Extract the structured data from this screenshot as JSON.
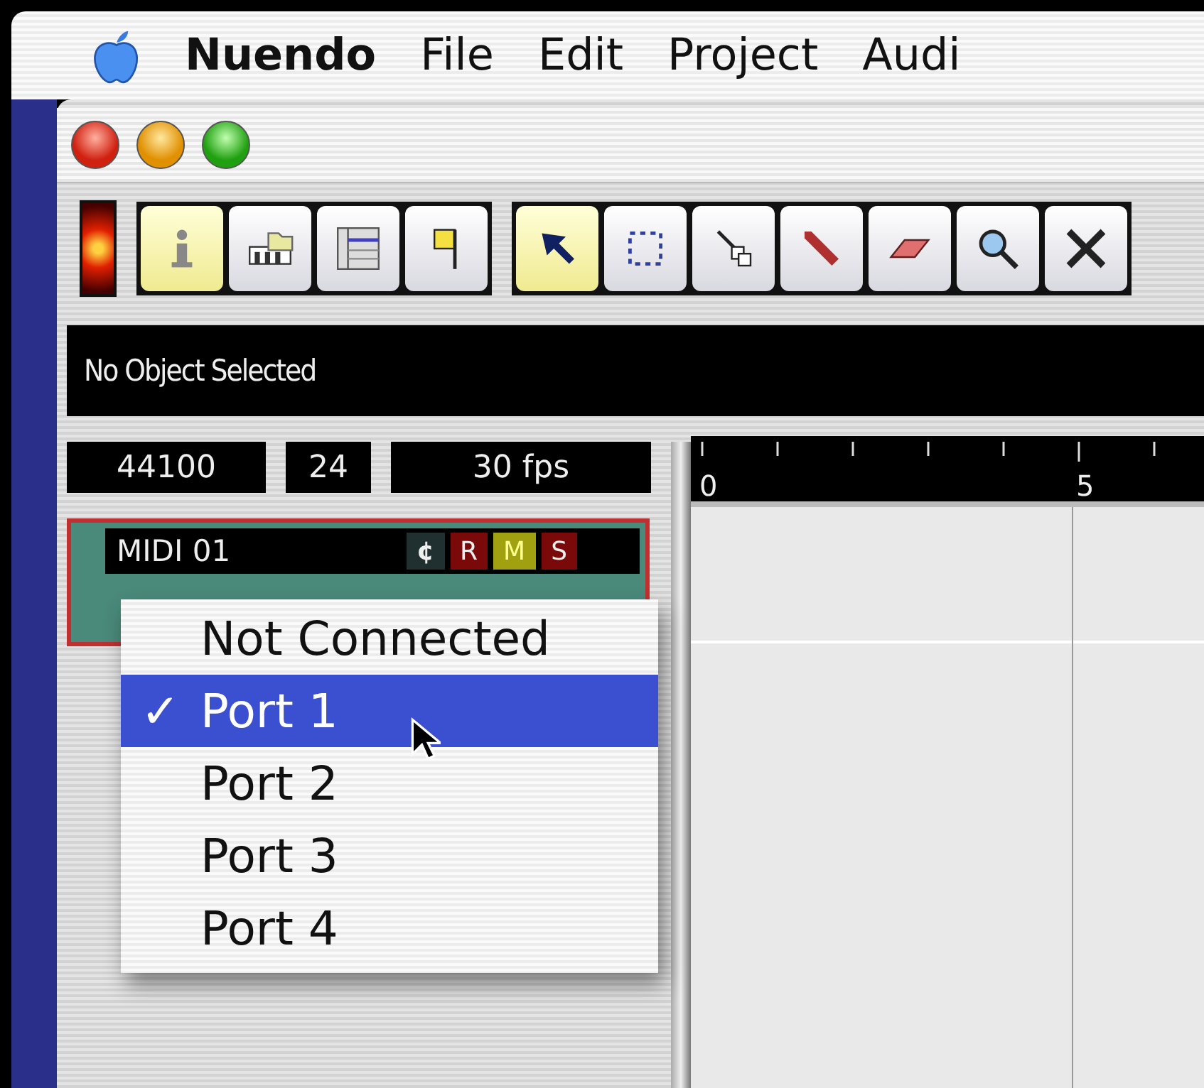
{
  "menu_bar": {
    "items": [
      {
        "label": "Nuendo",
        "kind": "app"
      },
      {
        "label": "File",
        "kind": "menu"
      },
      {
        "label": "Edit",
        "kind": "menu"
      },
      {
        "label": "Project",
        "kind": "menu"
      },
      {
        "label": "Audi",
        "kind": "menu"
      }
    ]
  },
  "toolbar": {
    "activity_led": {
      "on": true
    },
    "groups": [
      [
        {
          "kind": "info",
          "selected": true
        },
        {
          "kind": "pool",
          "selected": false
        },
        {
          "kind": "browser",
          "selected": false
        },
        {
          "kind": "marker",
          "selected": false
        }
      ],
      [
        {
          "kind": "arrow",
          "selected": true
        },
        {
          "kind": "range",
          "selected": false
        },
        {
          "kind": "split",
          "selected": false
        },
        {
          "kind": "glue",
          "selected": false
        },
        {
          "kind": "erase",
          "selected": false
        },
        {
          "kind": "zoom",
          "selected": false
        },
        {
          "kind": "mute",
          "selected": false
        }
      ]
    ]
  },
  "info_line": {
    "text": "No Object Selected"
  },
  "project_settings": [
    "44100",
    "24",
    "30 fps"
  ],
  "ruler": {
    "labels": [
      {
        "text": "0"
      },
      {
        "text": "5"
      }
    ]
  },
  "track": {
    "name": "MIDI 01",
    "edit_label": "¢",
    "buttons": [
      {
        "label": "R",
        "on": false
      },
      {
        "label": "M",
        "on": true
      },
      {
        "label": "S",
        "on": false
      }
    ]
  },
  "port_menu": {
    "items": [
      {
        "label": "Not Connected",
        "selected": false
      },
      {
        "label": "Port 1",
        "selected": true,
        "check_mark": "✓"
      },
      {
        "label": "Port 2",
        "selected": false
      },
      {
        "label": "Port 3",
        "selected": false
      },
      {
        "label": "Port 4",
        "selected": false
      }
    ]
  }
}
